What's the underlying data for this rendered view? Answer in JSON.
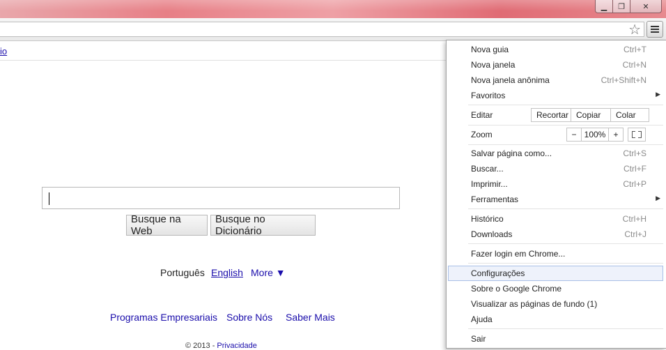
{
  "window": {
    "minimize_glyph": "▁",
    "maximize_glyph": "❐",
    "close_glyph": "✕"
  },
  "toolbar": {
    "star_glyph": "☆"
  },
  "page": {
    "topbar_link": "io",
    "search_value": "",
    "buttons": {
      "web": "Busque na Web",
      "dictionary": "Busque no Dicionário"
    },
    "languages": {
      "portuguese": "Português",
      "english": "English",
      "more": "More ▼"
    },
    "footer": {
      "business": "Programas Empresariais",
      "about": "Sobre Nós",
      "learn_more": "Saber Mais"
    },
    "copyright": "© 2013 -",
    "privacy": "Privacidade"
  },
  "menu": {
    "nova_guia": {
      "label": "Nova guia",
      "shortcut": "Ctrl+T"
    },
    "nova_janela": {
      "label": "Nova janela",
      "shortcut": "Ctrl+N"
    },
    "nova_janela_anonima": {
      "label": "Nova janela anônima",
      "shortcut": "Ctrl+Shift+N"
    },
    "favoritos": {
      "label": "Favoritos"
    },
    "editar": {
      "label": "Editar",
      "recortar": "Recortar",
      "copiar": "Copiar",
      "colar": "Colar"
    },
    "zoom": {
      "label": "Zoom",
      "minus": "−",
      "value": "100%",
      "plus": "+"
    },
    "salvar": {
      "label": "Salvar página como...",
      "shortcut": "Ctrl+S"
    },
    "buscar": {
      "label": "Buscar...",
      "shortcut": "Ctrl+F"
    },
    "imprimir": {
      "label": "Imprimir...",
      "shortcut": "Ctrl+P"
    },
    "ferramentas": {
      "label": "Ferramentas"
    },
    "historico": {
      "label": "Histórico",
      "shortcut": "Ctrl+H"
    },
    "downloads": {
      "label": "Downloads",
      "shortcut": "Ctrl+J"
    },
    "login": {
      "label": "Fazer login em Chrome..."
    },
    "configuracoes": {
      "label": "Configurações"
    },
    "sobre": {
      "label": "Sobre o Google Chrome"
    },
    "visualizar": {
      "label": "Visualizar as páginas de fundo (1)"
    },
    "ajuda": {
      "label": "Ajuda"
    },
    "sair": {
      "label": "Sair"
    },
    "submenu_arrow": "▶",
    "highlight_color": "#eef2fb"
  }
}
